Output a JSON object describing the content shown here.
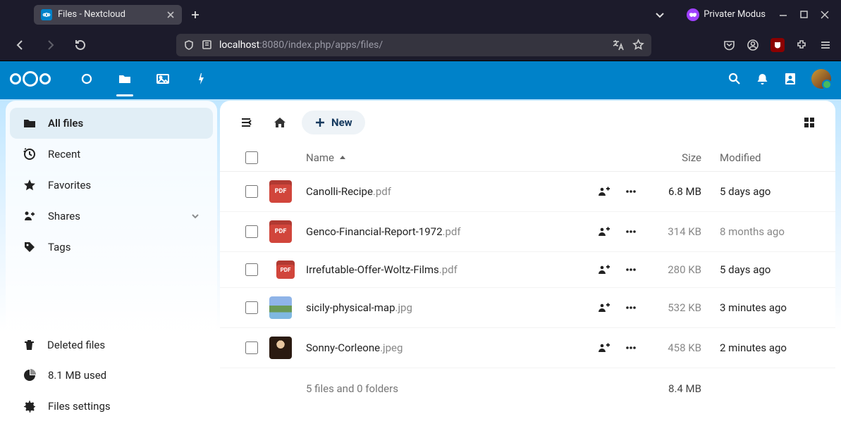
{
  "browser": {
    "tab_title": "Files - Nextcloud",
    "private_label": "Privater Modus",
    "url_host": "localhost",
    "url_port": ":8080",
    "url_path": "/index.php/apps/files/"
  },
  "sidebar": {
    "items": [
      {
        "label": "All files",
        "icon": "folder",
        "active": true
      },
      {
        "label": "Recent",
        "icon": "clock"
      },
      {
        "label": "Favorites",
        "icon": "star"
      },
      {
        "label": "Shares",
        "icon": "share",
        "chevron": true
      },
      {
        "label": "Tags",
        "icon": "tag"
      }
    ],
    "lower": [
      {
        "label": "Deleted files",
        "icon": "trash"
      },
      {
        "label": "8.1 MB used",
        "icon": "pie"
      },
      {
        "label": "Files settings",
        "icon": "gear"
      }
    ]
  },
  "toolbar": {
    "new_label": "New"
  },
  "columns": {
    "name": "Name",
    "size": "Size",
    "modified": "Modified"
  },
  "files": [
    {
      "name": "Canolli-Recipe",
      "ext": ".pdf",
      "thumb": "pdf",
      "size": "6.8 MB",
      "size_dark": true,
      "modified": "5 days ago"
    },
    {
      "name": "Genco-Financial-Report-1972",
      "ext": ".pdf",
      "thumb": "pdf",
      "size": "314 KB",
      "modified": "8 months ago",
      "mod_dim": true
    },
    {
      "name": "Irrefutable-Offer-Woltz-Films",
      "ext": ".pdf",
      "thumb": "pdf-small",
      "size": "280 KB",
      "modified": "5 days ago"
    },
    {
      "name": "sicily-physical-map",
      "ext": ".jpg",
      "thumb": "map",
      "size": "532 KB",
      "modified": "3 minutes ago"
    },
    {
      "name": "Sonny-Corleone",
      "ext": ".jpeg",
      "thumb": "person",
      "size": "458 KB",
      "modified": "2 minutes ago"
    }
  ],
  "summary": {
    "text": "5 files and 0 folders",
    "total_size": "8.4 MB"
  }
}
